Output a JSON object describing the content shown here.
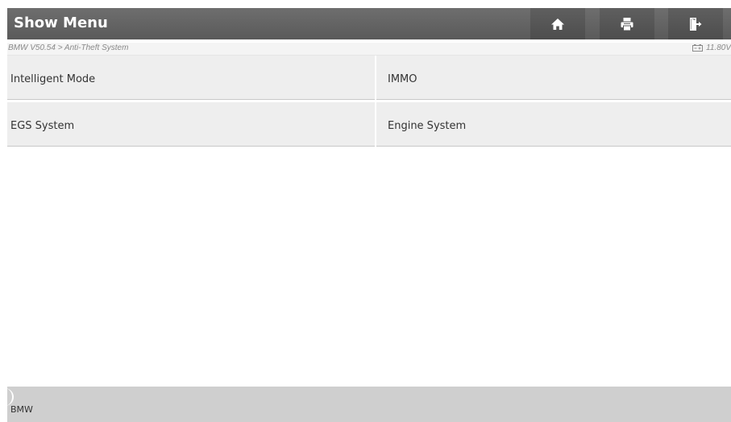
{
  "header": {
    "title": "Show Menu",
    "buttons": [
      {
        "name": "home",
        "icon": "home-icon"
      },
      {
        "name": "print",
        "icon": "printer-icon"
      },
      {
        "name": "exit",
        "icon": "exit-icon"
      }
    ]
  },
  "breadcrumb": "BMW V50.54 > Anti-Theft System",
  "battery": {
    "icon": "battery-icon",
    "voltage": "11.80V"
  },
  "menu": {
    "items": [
      {
        "label": "Intelligent Mode"
      },
      {
        "label": "IMMO"
      },
      {
        "label": "EGS System"
      },
      {
        "label": "Engine System"
      }
    ]
  },
  "footer": {
    "label": "BMW"
  },
  "colors": {
    "titlebar": "#626262",
    "menu_item_bg": "#eeeeee",
    "footer_bg": "#cfcfcf"
  }
}
